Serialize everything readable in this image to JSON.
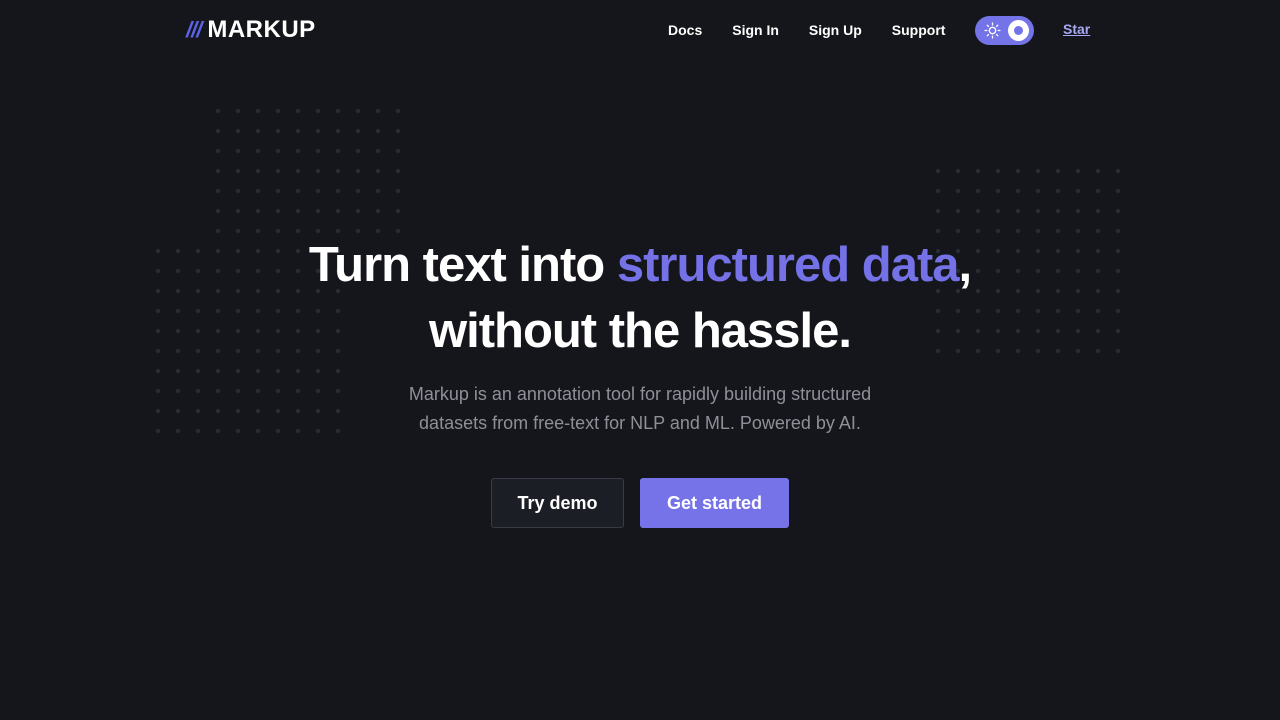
{
  "header": {
    "logo_mark": "///",
    "logo_text": "MARKUP",
    "nav": [
      {
        "label": "Docs"
      },
      {
        "label": "Sign In"
      },
      {
        "label": "Sign Up"
      },
      {
        "label": "Support"
      }
    ],
    "theme_toggle": {
      "icon": "sun-icon",
      "state": "dark"
    },
    "star_label": "Star"
  },
  "hero": {
    "title_part1": "Turn text into ",
    "title_accent": "structured data",
    "title_part2": ",",
    "title_line2": "without the hassle.",
    "subtitle_line1": "Markup is an annotation tool for rapidly building structured",
    "subtitle_line2": "datasets from free-text for NLP and ML. Powered by AI.",
    "try_demo_label": "Try demo",
    "get_started_label": "Get started"
  },
  "colors": {
    "background": "#15161b",
    "accent": "#7472e6",
    "subtitle": "#8e9099",
    "dot": "#2b2d36"
  }
}
